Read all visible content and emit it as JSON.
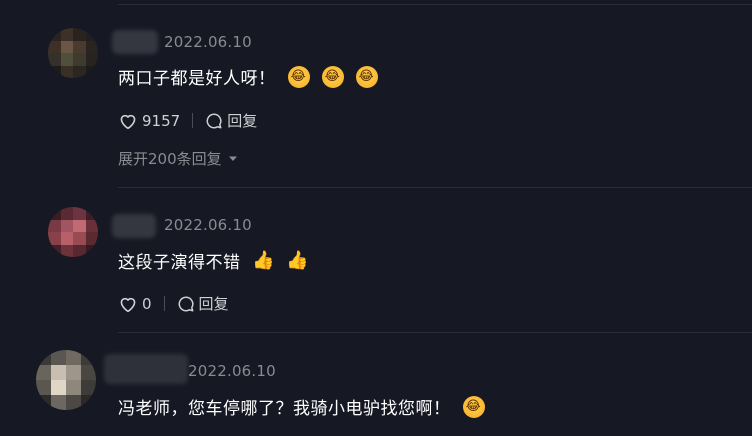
{
  "comments": [
    {
      "date": "2022.06.10",
      "text": "两口子都是好人呀！",
      "emojis": [
        "laugh-cry-emoji",
        "laugh-cry-emoji",
        "laugh-cry-emoji"
      ],
      "likes": "9157",
      "reply_label": "回复",
      "expand_label": "展开200条回复"
    },
    {
      "date": "2022.06.10",
      "text": "这段子演得不错",
      "emojis": [
        "thumbs-up-emoji",
        "thumbs-up-emoji"
      ],
      "likes": "0",
      "reply_label": "回复"
    },
    {
      "date": "2022.06.10",
      "text": "冯老师，您车停哪了？我骑小电驴找您啊！",
      "emojis": [
        "laugh-cry-emoji"
      ]
    }
  ],
  "colors": {
    "background": "#161823",
    "text": "#ffffff",
    "muted": "#8a8b91",
    "action": "#cfd0d3"
  }
}
